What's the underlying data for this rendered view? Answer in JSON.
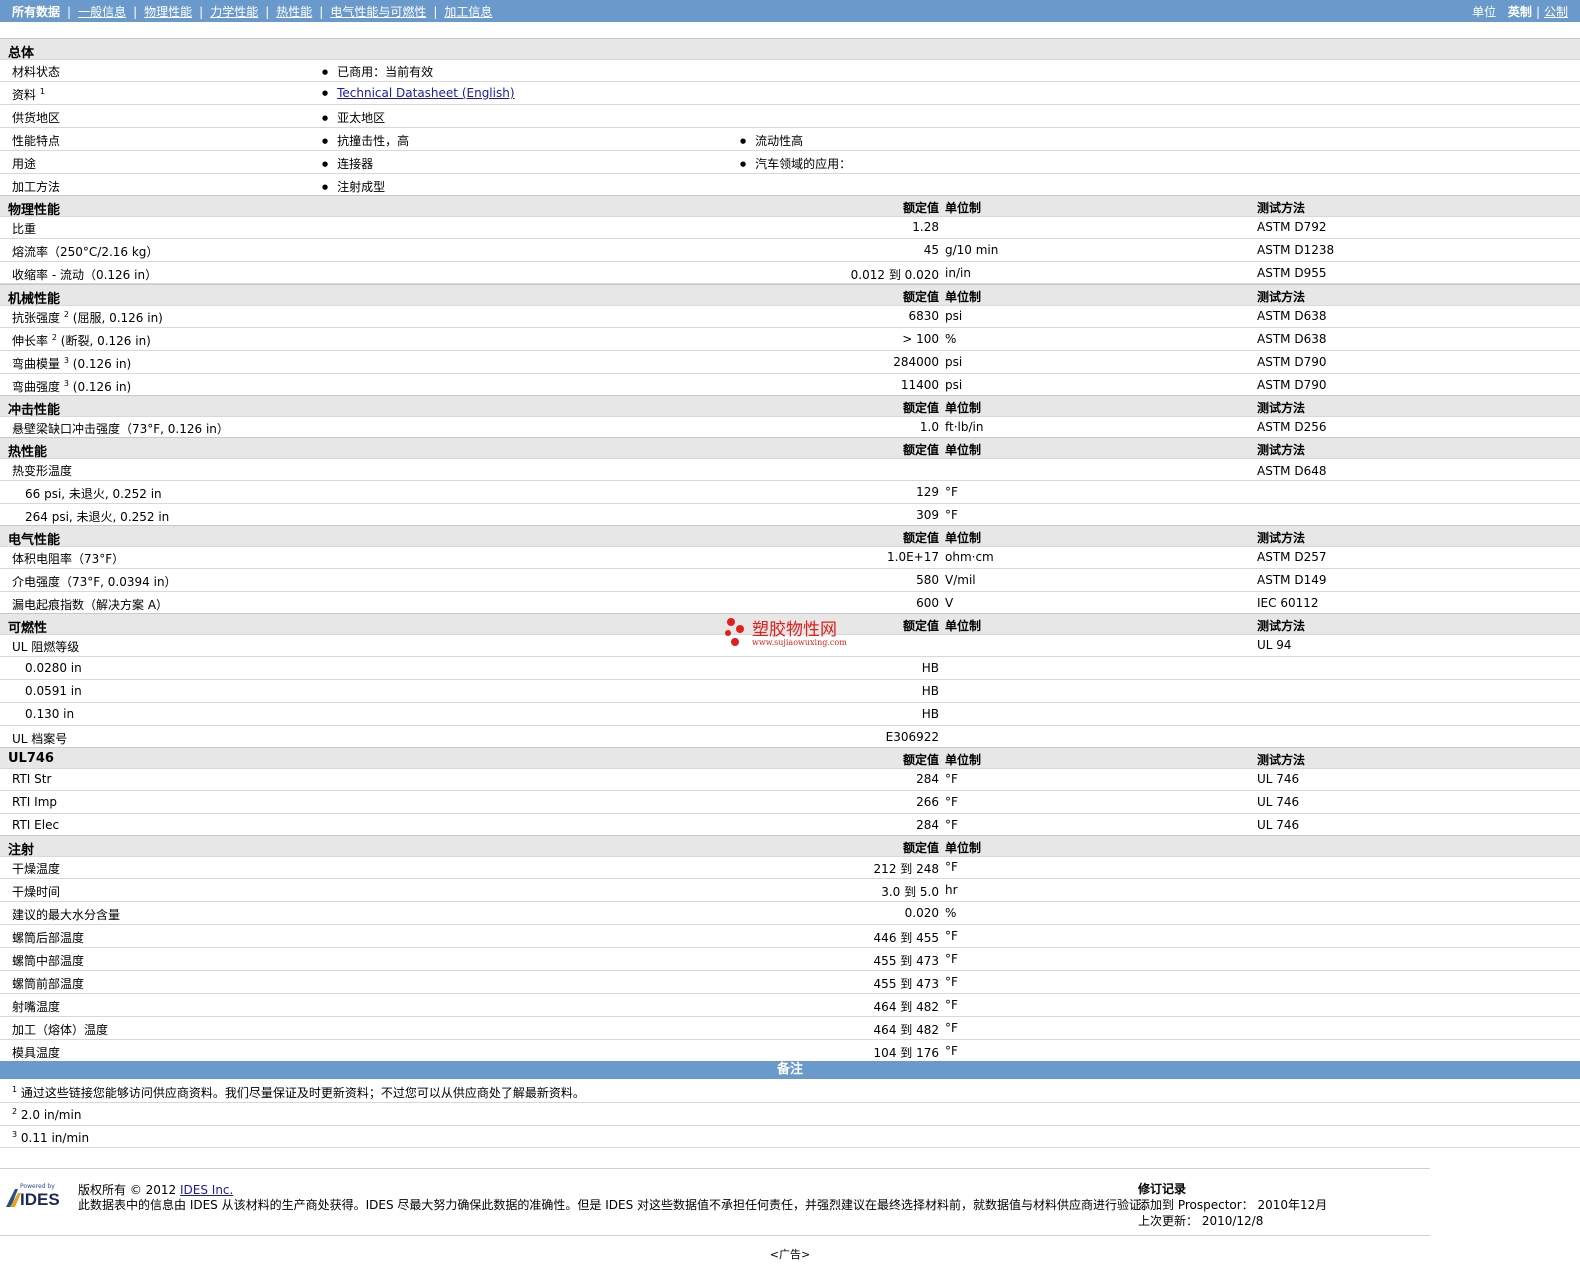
{
  "nav": {
    "items": [
      "所有数据",
      "一般信息",
      "物理性能",
      "力学性能",
      "热性能",
      "电气性能与可燃性",
      "加工信息"
    ],
    "units_label": "单位",
    "units_imperial": "英制",
    "units_metric": "公制"
  },
  "general": {
    "title": "总体",
    "status_label": "材料状态",
    "status_value": "已商用：当前有效",
    "docs_label": "资料",
    "docs_sup": "1",
    "docs_link": "Technical Datasheet (English)",
    "region_label": "供货地区",
    "region_value": "亚太地区",
    "features_label": "性能特点",
    "features": [
      "抗撞击性，高",
      "流动性高"
    ],
    "uses_label": "用途",
    "uses": [
      "连接器",
      "汽车领域的应用："
    ],
    "processing_label": "加工方法",
    "processing_value": "注射成型"
  },
  "cols": {
    "nominal": "额定值",
    "unit": "单位制",
    "test": "测试方法"
  },
  "physical": {
    "title": "物理性能",
    "rows": [
      {
        "label": "比重",
        "value": "1.28",
        "unit": "",
        "test": "ASTM D792"
      },
      {
        "label": "熔流率（250°C/2.16 kg）",
        "value": "45",
        "unit": "g/10 min",
        "test": "ASTM D1238"
      },
      {
        "label": "收缩率 - 流动（0.126 in）",
        "value": "0.012 到  0.020",
        "unit": "in/in",
        "test": "ASTM D955"
      }
    ]
  },
  "mechanical": {
    "title": "机械性能",
    "rows": [
      {
        "label": "抗张强度",
        "sup": "2",
        "label2": "(屈服, 0.126 in)",
        "value": "6830",
        "unit": "psi",
        "test": "ASTM D638"
      },
      {
        "label": "伸长率",
        "sup": "2",
        "label2": "(断裂, 0.126 in)",
        "value": "> 100",
        "unit": "%",
        "test": "ASTM D638"
      },
      {
        "label": "弯曲模量",
        "sup": "3",
        "label2": "(0.126 in)",
        "value": "284000",
        "unit": "psi",
        "test": "ASTM D790"
      },
      {
        "label": "弯曲强度",
        "sup": "3",
        "label2": "(0.126 in)",
        "value": "11400",
        "unit": "psi",
        "test": "ASTM D790"
      }
    ]
  },
  "impact": {
    "title": "冲击性能",
    "rows": [
      {
        "label": "悬壁梁缺口冲击强度（73°F, 0.126 in）",
        "value": "1.0",
        "unit": "ft·lb/in",
        "test": "ASTM D256"
      }
    ]
  },
  "thermal": {
    "title": "热性能",
    "hdt_label": "热变形温度",
    "hdt_test": "ASTM D648",
    "rows": [
      {
        "label": "66 psi, 未退火, 0.252 in",
        "value": "129",
        "unit": "°F"
      },
      {
        "label": "264 psi, 未退火, 0.252 in",
        "value": "309",
        "unit": "°F"
      }
    ]
  },
  "electrical": {
    "title": "电气性能",
    "rows": [
      {
        "label": "体积电阻率（73°F）",
        "value": "1.0E+17",
        "unit": "ohm·cm",
        "test": "ASTM D257"
      },
      {
        "label": "介电强度（73°F, 0.0394 in）",
        "value": "580",
        "unit": "V/mil",
        "test": "ASTM D149"
      },
      {
        "label": "漏电起痕指数（解决方案 A）",
        "value": "600",
        "unit": "V",
        "test": "IEC 60112"
      }
    ]
  },
  "flammability": {
    "title": "可燃性",
    "ul_label": "UL 阻燃等级",
    "ul_test": "UL 94",
    "rows": [
      {
        "label": "0.0280 in",
        "value": "HB"
      },
      {
        "label": "0.0591 in",
        "value": "HB"
      },
      {
        "label": "0.130 in",
        "value": "HB"
      }
    ],
    "file_label": "UL 档案号",
    "file_value": "E306922"
  },
  "ul746": {
    "title": "UL746",
    "rows": [
      {
        "label": "RTI Str",
        "value": "284",
        "unit": "°F",
        "test": "UL 746"
      },
      {
        "label": "RTI Imp",
        "value": "266",
        "unit": "°F",
        "test": "UL 746"
      },
      {
        "label": "RTI Elec",
        "value": "284",
        "unit": "°F",
        "test": "UL 746"
      }
    ]
  },
  "injection": {
    "title": "注射",
    "rows": [
      {
        "label": "干燥温度",
        "value": "212 到  248",
        "unit": "°F"
      },
      {
        "label": "干燥时间",
        "value": "3.0 到  5.0",
        "unit": "hr"
      },
      {
        "label": "建议的最大水分含量",
        "value": "0.020",
        "unit": "%"
      },
      {
        "label": "螺筒后部温度",
        "value": "446 到  455",
        "unit": "°F"
      },
      {
        "label": "螺筒中部温度",
        "value": "455 到  473",
        "unit": "°F"
      },
      {
        "label": "螺筒前部温度",
        "value": "455 到  473",
        "unit": "°F"
      },
      {
        "label": "射嘴温度",
        "value": "464 到  482",
        "unit": "°F"
      },
      {
        "label": "加工（熔体）温度",
        "value": "464 到  482",
        "unit": "°F"
      },
      {
        "label": "模具温度",
        "value": "104 到  176",
        "unit": "°F"
      }
    ]
  },
  "notes": {
    "title": "备注",
    "items": [
      {
        "num": "1",
        "text": "通过这些链接您能够访问供应商资料。我们尽量保证及时更新资料；不过您可以从供应商处了解最新资料。"
      },
      {
        "num": "2",
        "text": "2.0 in/min"
      },
      {
        "num": "3",
        "text": "0.11 in/min"
      }
    ]
  },
  "footer": {
    "logo_small": "Powered by",
    "logo_text": "IDES",
    "copyright": "版权所有  © 2012 ",
    "company": "IDES Inc.",
    "disclaimer": "此数据表中的信息由  IDES 从该材料的生产商处获得。IDES 尽最大努力确保此数据的准确性。但是  IDES 对这些数据值不承担任何责任，并强烈建议在最终选择材料前，就数据值与材料供应商进行验证。",
    "rev_title": "修订记录",
    "rev_added": "添加到  Prospector：  2010年12月",
    "rev_updated": "上次更新：  2010/12/8",
    "ad": "<广告>"
  },
  "watermark": {
    "text": "塑胶物性网",
    "url": "www.sujiaowuxing.com",
    "color": "#e0201b"
  }
}
